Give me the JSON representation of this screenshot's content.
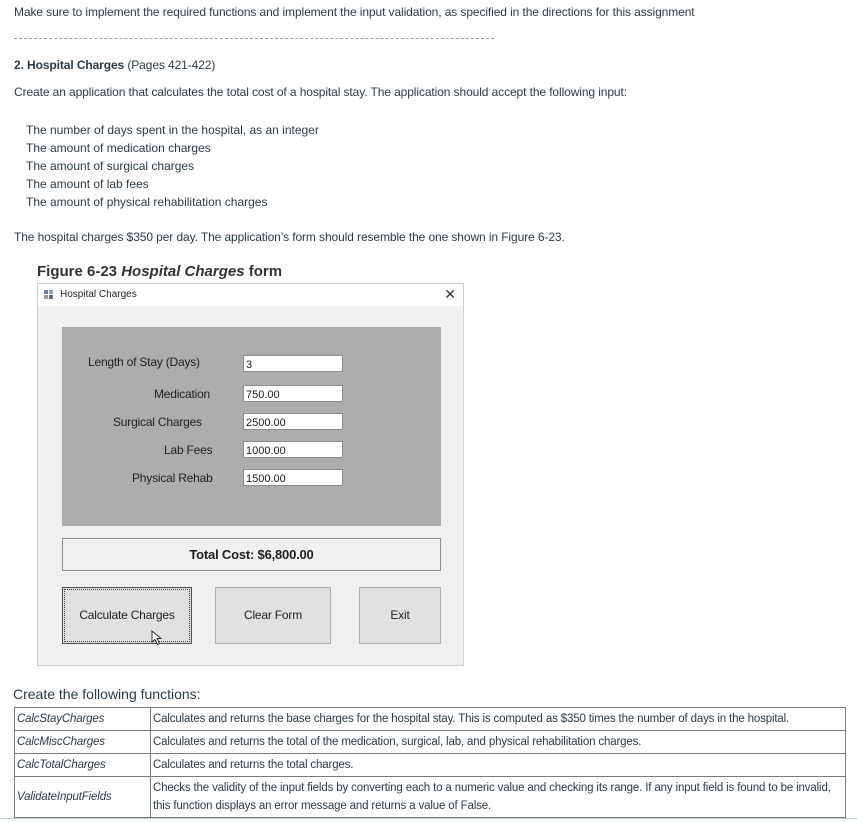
{
  "intro": "Make sure to implement the required functions and implement the input validation, as specified in the directions for this assignment",
  "section": {
    "heading_bold": "2. Hospital Charges",
    "heading_pages": " (Pages 421-422)",
    "description": "Create an application that calculates the total cost of a hospital stay. The application should accept the following input:",
    "inputs": [
      "The number of days spent in the hospital, as an integer",
      "The amount of medication charges",
      "The amount of surgical charges",
      "The amount of lab fees",
      "The amount of physical rehabilitation charges"
    ],
    "rate_note": "The hospital charges $350 per day. The application’s form should resemble the one shown in Figure 6-23."
  },
  "figure": {
    "caption_prefix": "Figure 6-23 ",
    "caption_italic": "Hospital Charges",
    "caption_suffix": " form",
    "window": {
      "title": "Hospital Charges",
      "close_glyph": "✕",
      "fields": [
        {
          "label": "Length of Stay (Days)",
          "value": "3"
        },
        {
          "label": "Medication",
          "value": "750.00"
        },
        {
          "label": "Surgical Charges",
          "value": "2500.00"
        },
        {
          "label": "Lab Fees",
          "value": "1000.00"
        },
        {
          "label": "Physical Rehab",
          "value": "1500.00"
        }
      ],
      "total": "Total Cost: $6,800.00",
      "buttons": {
        "calculate": "Calculate Charges",
        "clear": "Clear Form",
        "exit": "Exit"
      }
    }
  },
  "functions": {
    "title": "Create the following functions:",
    "rows": [
      {
        "name": "CalcStayCharges",
        "desc": "Calculates and returns the base charges for the hospital stay. This is computed as $350 times the number of days in the hospital."
      },
      {
        "name": "CalcMiscCharges",
        "desc": "Calculates and returns the total of the medication, surgical, lab, and physical rehabilitation charges."
      },
      {
        "name": "CalcTotalCharges",
        "desc": "Calculates and returns the total charges."
      },
      {
        "name": "ValidateInputFields",
        "desc": "Checks the validity of the input fields by converting each to a numeric value and checking its range. If any input field is found to be invalid, this function displays an error message and returns a value of False."
      }
    ]
  }
}
